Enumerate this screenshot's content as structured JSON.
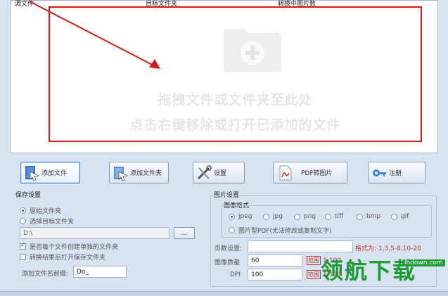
{
  "list": {
    "columns": [
      "源文件",
      "目标文件夹",
      "转换中图片数"
    ],
    "drop_hint_1": "拖拽文件或文件夹至此处",
    "drop_hint_2": "点击右键移除或打开已添加的文件"
  },
  "buttons": {
    "add_file": "添加文件",
    "add_folder": "添加文件夹",
    "settings": "设置",
    "pdf_to_image": "PDF转图片",
    "register": "注册"
  },
  "save_settings": {
    "title": "保存设置",
    "option_original": "原始文件夹",
    "option_target": "选择目标文件夹",
    "path_value": "D:\\",
    "browse_label": "...",
    "check_create_folder": "是否每个文件创建单独的文件夹",
    "check_open_folder": "转换结果后打开保存文件夹",
    "prefix_label": "添加文件名前缀:",
    "prefix_value": "Do_"
  },
  "image_settings": {
    "title": "图片设置",
    "format_title": "图像格式",
    "formats": [
      "jpeg",
      "jpg",
      "png",
      "tiff",
      "bmp",
      "gif"
    ],
    "pdf_option": "图片型PDF(无法修改或复制文字)",
    "page_label": "页数设置:",
    "page_value": "",
    "format_hint": "格式为: 1,3,5-8,10-20",
    "quality_label": "图像质量",
    "quality_value": "60",
    "quality_range": "1-100",
    "dpi_label": "DPI",
    "dpi_value": "100",
    "dpi_range": "1-100",
    "range_tag": "范围"
  },
  "watermark": {
    "text": "领航下载",
    "url": "lhdown.com"
  },
  "colors": {
    "highlight_red": "#d61a1a",
    "accent_blue": "#2563c9",
    "watermark_green": "#1f9a36"
  }
}
